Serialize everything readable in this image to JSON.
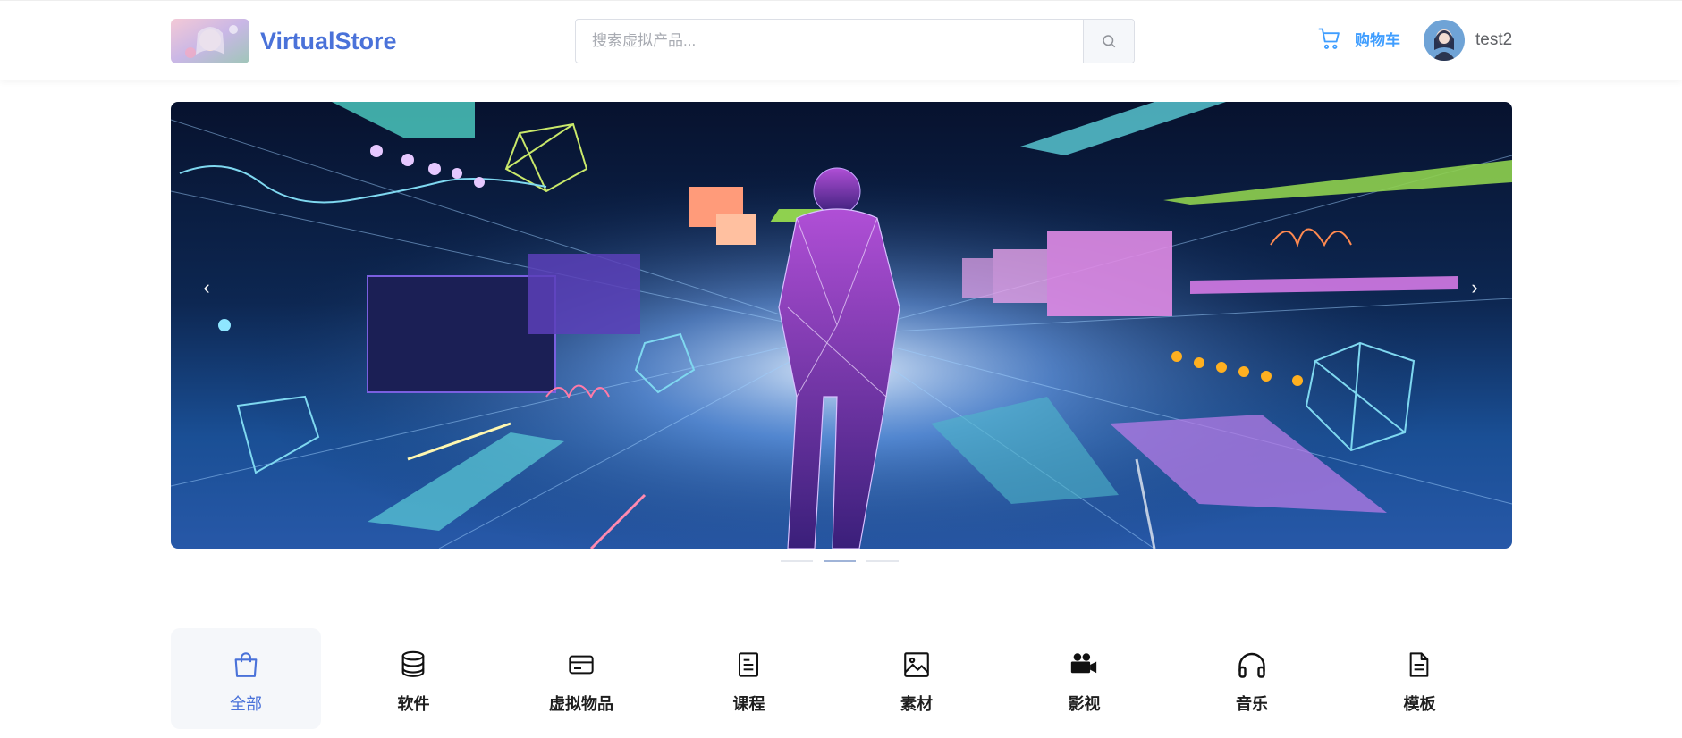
{
  "header": {
    "brand": "VirtualStore",
    "search_placeholder": "搜索虚拟产品...",
    "cart_label": "购物车",
    "username": "test2"
  },
  "banner": {
    "prev_arrow": "‹",
    "next_arrow": "›",
    "slide_count": 3,
    "active_slide": 2
  },
  "categories": [
    {
      "label": "全部",
      "icon": "shopping-bag-icon",
      "active": true
    },
    {
      "label": "软件",
      "icon": "database-icon",
      "active": false
    },
    {
      "label": "虚拟物品",
      "icon": "credit-card-icon",
      "active": false
    },
    {
      "label": "课程",
      "icon": "document-icon",
      "active": false
    },
    {
      "label": "素材",
      "icon": "image-icon",
      "active": false
    },
    {
      "label": "影视",
      "icon": "video-camera-icon",
      "active": false
    },
    {
      "label": "音乐",
      "icon": "headphones-icon",
      "active": false
    },
    {
      "label": "模板",
      "icon": "template-icon",
      "active": false
    }
  ],
  "colors": {
    "accent": "#4a72d9",
    "link": "#409eff"
  }
}
